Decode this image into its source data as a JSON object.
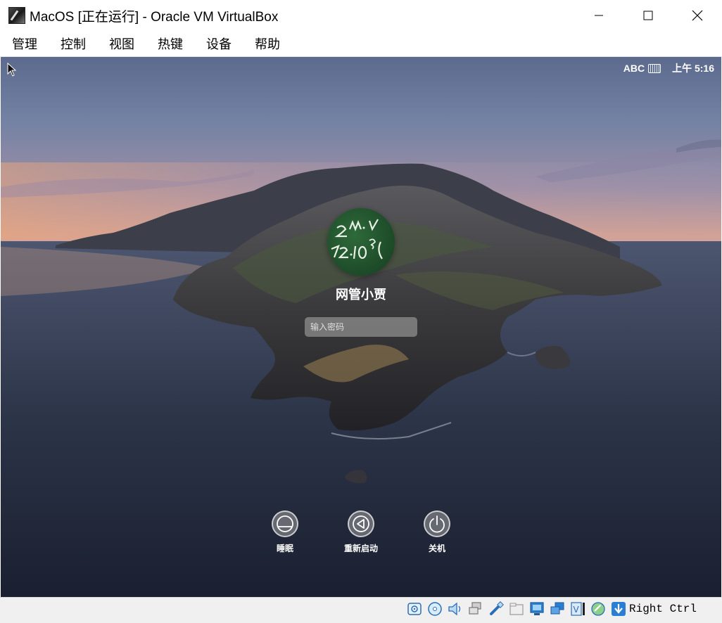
{
  "window": {
    "title": "MacOS [正在运行] - Oracle VM VirtualBox",
    "controls": {
      "minimize": "─",
      "maximize": "☐",
      "close": "✕"
    }
  },
  "menu": {
    "items": [
      {
        "label": "管理"
      },
      {
        "label": "控制"
      },
      {
        "label": "视图"
      },
      {
        "label": "热键"
      },
      {
        "label": "设备"
      },
      {
        "label": "帮助"
      }
    ]
  },
  "vm": {
    "input_source": "ABC",
    "clock": "上午 5:16",
    "login": {
      "username": "网管小贾",
      "password_placeholder": "输入密码"
    },
    "power_buttons": [
      {
        "label": "睡眠",
        "icon": "sleep-icon"
      },
      {
        "label": "重新启动",
        "icon": "restart-icon"
      },
      {
        "label": "关机",
        "icon": "shutdown-icon"
      }
    ]
  },
  "statusbar": {
    "icons": [
      "hard-disk-icon",
      "optical-drive-icon",
      "audio-icon",
      "network-icon",
      "usb-icon",
      "shared-folders-icon",
      "display-icon",
      "recording-icon",
      "cpu-virtualization-icon",
      "mouse-integration-icon",
      "keyboard-capture-icon"
    ],
    "host_key": "Right Ctrl"
  }
}
